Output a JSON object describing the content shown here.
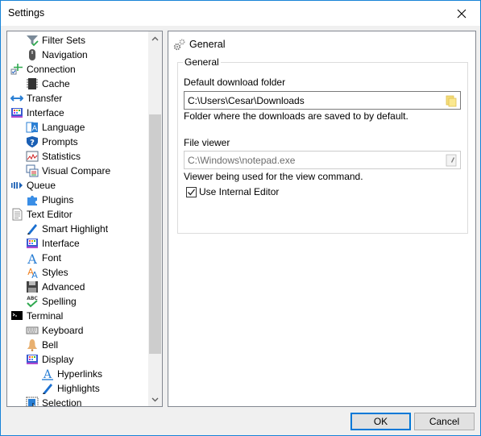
{
  "window": {
    "title": "Settings",
    "close_icon": "close-icon"
  },
  "tree": {
    "items": [
      {
        "label": "Filter Sets",
        "icon": "funnel-check-icon",
        "level": 1
      },
      {
        "label": "Navigation",
        "icon": "mouse-icon",
        "level": 1
      },
      {
        "label": "Connection",
        "icon": "connection-icon",
        "level": 0
      },
      {
        "label": "Cache",
        "icon": "chip-icon",
        "level": 1
      },
      {
        "label": "Transfer",
        "icon": "arrows-left-right-icon",
        "level": 0
      },
      {
        "label": "Interface",
        "icon": "palette-monitor-icon",
        "level": 0
      },
      {
        "label": "Language",
        "icon": "language-icon",
        "level": 1
      },
      {
        "label": "Prompts",
        "icon": "question-shield-icon",
        "level": 1
      },
      {
        "label": "Statistics",
        "icon": "chart-icon",
        "level": 1
      },
      {
        "label": "Visual Compare",
        "icon": "compare-windows-icon",
        "level": 1
      },
      {
        "label": "Queue",
        "icon": "queue-icon",
        "level": 0
      },
      {
        "label": "Plugins",
        "icon": "puzzle-icon",
        "level": 1
      },
      {
        "label": "Text Editor",
        "icon": "document-icon",
        "level": 0
      },
      {
        "label": "Smart Highlight",
        "icon": "pen-icon",
        "level": 1
      },
      {
        "label": "Interface",
        "icon": "palette-monitor-icon",
        "level": 1
      },
      {
        "label": "Font",
        "icon": "font-icon",
        "level": 1
      },
      {
        "label": "Styles",
        "icon": "styles-icon",
        "level": 1
      },
      {
        "label": "Advanced",
        "icon": "floppy-disk-icon",
        "level": 1
      },
      {
        "label": "Spelling",
        "icon": "spellcheck-icon",
        "level": 1
      },
      {
        "label": "Terminal",
        "icon": "terminal-icon",
        "level": 0
      },
      {
        "label": "Keyboard",
        "icon": "keyboard-icon",
        "level": 1
      },
      {
        "label": "Bell",
        "icon": "bell-icon",
        "level": 1
      },
      {
        "label": "Display",
        "icon": "palette-monitor-icon",
        "level": 1
      },
      {
        "label": "Hyperlinks",
        "icon": "font-underline-icon",
        "level": 2
      },
      {
        "label": "Highlights",
        "icon": "pen-icon",
        "level": 2
      },
      {
        "label": "Selection",
        "icon": "selection-icon",
        "level": 1
      }
    ]
  },
  "panel": {
    "header": "General",
    "group_title": "General",
    "download_folder_label": "Default download folder",
    "download_folder_value": "C:\\Users\\Cesar\\Downloads",
    "download_folder_hint": "Folder where the downloads are saved to by default.",
    "file_viewer_label": "File viewer",
    "file_viewer_value": "C:\\Windows\\notepad.exe",
    "file_viewer_hint": "Viewer being used for the view command.",
    "use_internal_editor_label": "Use Internal Editor",
    "use_internal_editor_checked": true
  },
  "buttons": {
    "ok": "OK",
    "cancel": "Cancel"
  },
  "colors": {
    "accent": "#0078d7",
    "window_border": "#1883d7"
  }
}
